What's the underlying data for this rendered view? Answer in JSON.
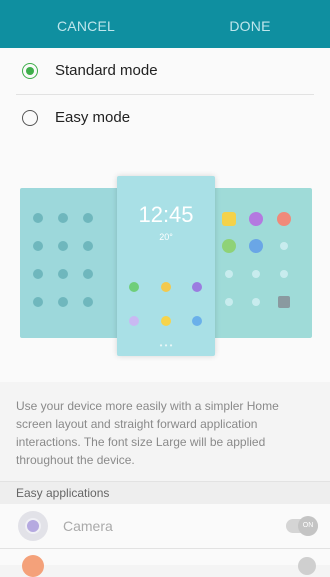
{
  "actionbar": {
    "cancel_label": "CANCEL",
    "done_label": "DONE",
    "color": "#0f8fa0"
  },
  "modes": [
    {
      "label": "Standard mode",
      "selected": true
    },
    {
      "label": "Easy mode",
      "selected": false
    }
  ],
  "preview": {
    "clock": "12:45",
    "weather": "20°"
  },
  "description": "Use your device more easily with a simpler Home screen layout and straight forward application interactions. The font size Large will be applied throughout the device.",
  "easy_apps": {
    "header": "Easy applications",
    "items": [
      {
        "label": "Camera",
        "toggle_text": "ON",
        "enabled": false
      }
    ]
  }
}
